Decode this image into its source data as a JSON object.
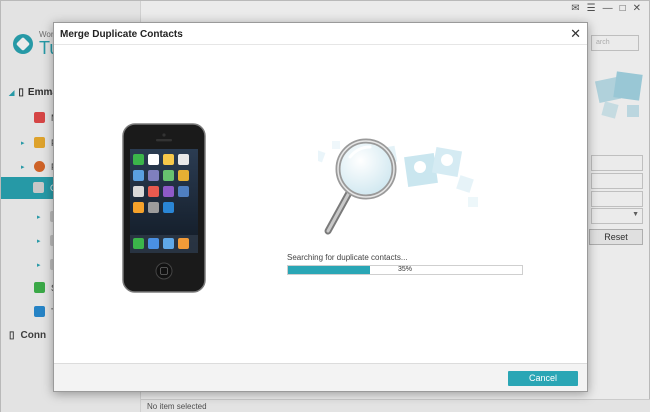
{
  "app": {
    "logo_small": "Won",
    "logo_big": "Tu",
    "device_name": "Emma",
    "sidebar_items": [
      {
        "label": "M",
        "icon": "music-icon",
        "color": "#e84b4b"
      },
      {
        "label": "Pl",
        "icon": "photos-icon",
        "color": "#f0b030"
      },
      {
        "label": "Pl",
        "icon": "photo-library-icon",
        "color": "#e06b2b"
      },
      {
        "label": "Co",
        "icon": "contacts-icon",
        "color": "#9a9a9a"
      },
      {
        "label": "",
        "icon": "sub-item-icon",
        "color": "#bdbdbd"
      },
      {
        "label": "",
        "icon": "sub-item-icon",
        "color": "#bdbdbd"
      },
      {
        "label": "",
        "icon": "sub-item-icon",
        "color": "#bdbdbd"
      },
      {
        "label": "Sl",
        "icon": "sms-icon",
        "color": "#3fb74e"
      },
      {
        "label": "To",
        "icon": "toolbox-icon",
        "color": "#2a8fd6"
      }
    ],
    "bottom_item": "Conn",
    "search_placeholder": "arch",
    "reset_label": "Reset",
    "status_text": "No item selected"
  },
  "dialog": {
    "title": "Merge Duplicate Contacts",
    "status_message": "Searching for duplicate contacts...",
    "progress_percent": 35,
    "progress_label": "35%",
    "cancel_label": "Cancel"
  },
  "colors": {
    "accent": "#2aa6b5"
  }
}
